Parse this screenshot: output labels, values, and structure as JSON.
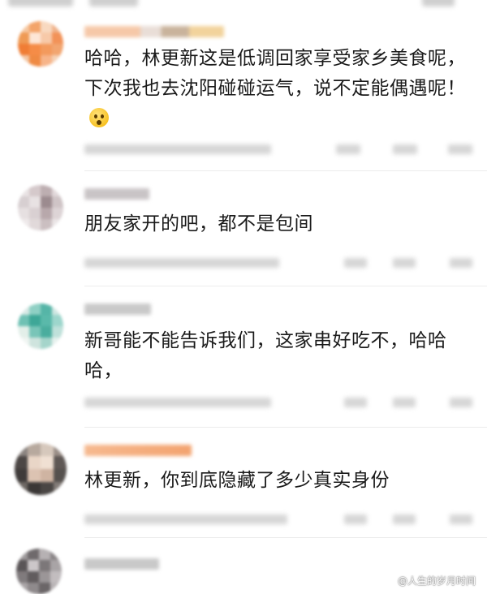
{
  "comments": [
    {
      "text": "哈哈，林更新这是低调回家享受家乡美食呢，下次我也去沈阳碰碰运气，说不定能偶遇呢！",
      "emoji": "scared-face-emoji"
    },
    {
      "text": "朋友家开的吧，都不是包间"
    },
    {
      "text": "新哥能不能告诉我们，这家串好吃不，哈哈哈，"
    },
    {
      "text": "林更新，你到底隐藏了多少真实身份"
    }
  ],
  "watermark": "@人生的岁月时间",
  "colors": {
    "text": "#1a1a1a",
    "divider": "#ececec",
    "blur": "#d6d6d6"
  }
}
